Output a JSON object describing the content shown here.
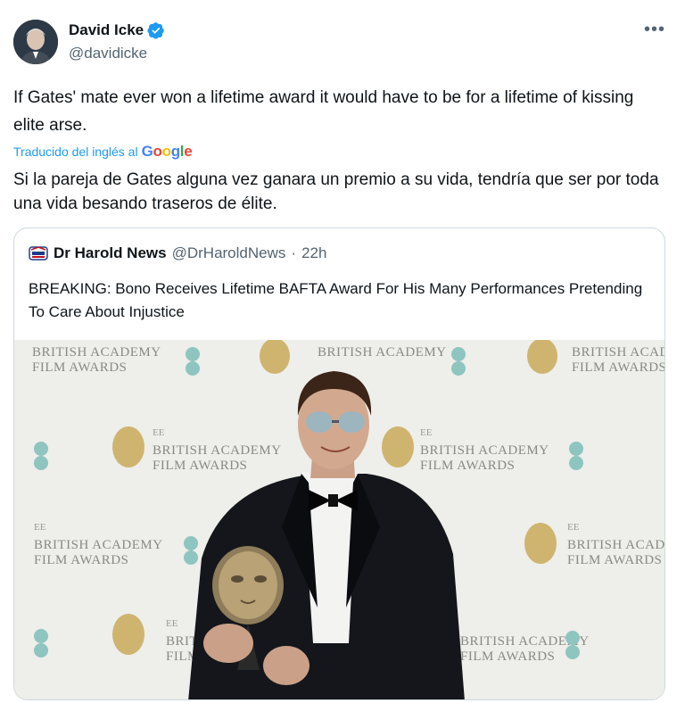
{
  "author": {
    "name": "David Icke",
    "handle": "@davidicke"
  },
  "tweet": {
    "text": "If Gates' mate ever won a lifetime award it would have to be for a lifetime of kissing elite arse.",
    "translated_label": "Traducido del inglés al",
    "translator": "Google",
    "translation": "Si la pareja de Gates alguna vez ganara un premio a su vida, tendría que ser por toda una vida besando traseros de élite."
  },
  "quote": {
    "name": "Dr Harold News",
    "handle": "@DrHaroldNews",
    "separator": "·",
    "time": "22h",
    "text": "BREAKING: Bono Receives Lifetime BAFTA Award For His Many Performances Pretending To Care About Injustice"
  },
  "backdrop": {
    "line1": "BRITISH ACADEMY",
    "line2": "FILM AWARDS",
    "ee": "EE"
  },
  "colors": {
    "link": "#1d9bf0",
    "verified": "#1d9bf0",
    "secondary_text": "#536471"
  }
}
